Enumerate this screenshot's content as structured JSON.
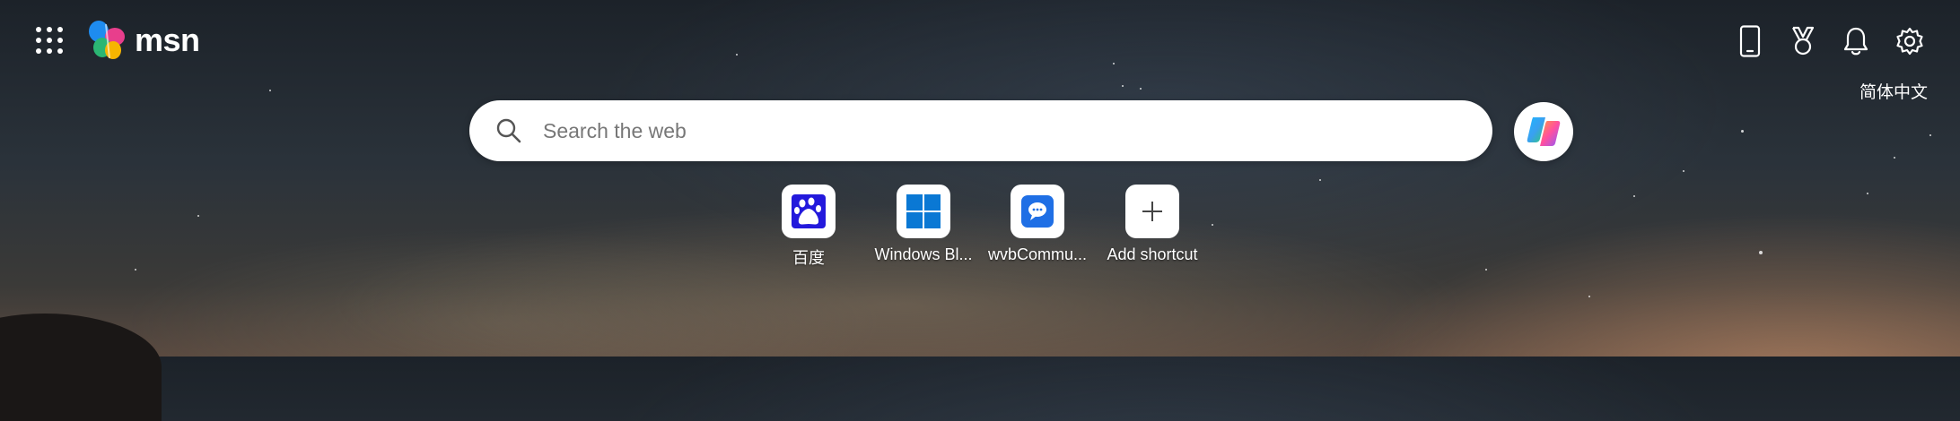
{
  "header": {
    "brand": "msn",
    "language": "简体中文",
    "icons": [
      "apps-launcher-icon",
      "phone-icon",
      "rewards-trophy-icon",
      "notifications-bell-icon",
      "settings-gear-icon"
    ]
  },
  "search": {
    "placeholder": "Search the web"
  },
  "shortcuts": [
    {
      "label": "百度",
      "icon": "baidu-icon"
    },
    {
      "label": "Windows Bl...",
      "icon": "windows-icon"
    },
    {
      "label": "wvbCommu...",
      "icon": "chat-bubble-icon"
    },
    {
      "label": "Add shortcut",
      "icon": "plus-icon"
    }
  ],
  "colors": {
    "baidu_blue": "#2319dc",
    "windows_blue": "#0a78d4",
    "chat_blue": "#1f6fe5"
  }
}
